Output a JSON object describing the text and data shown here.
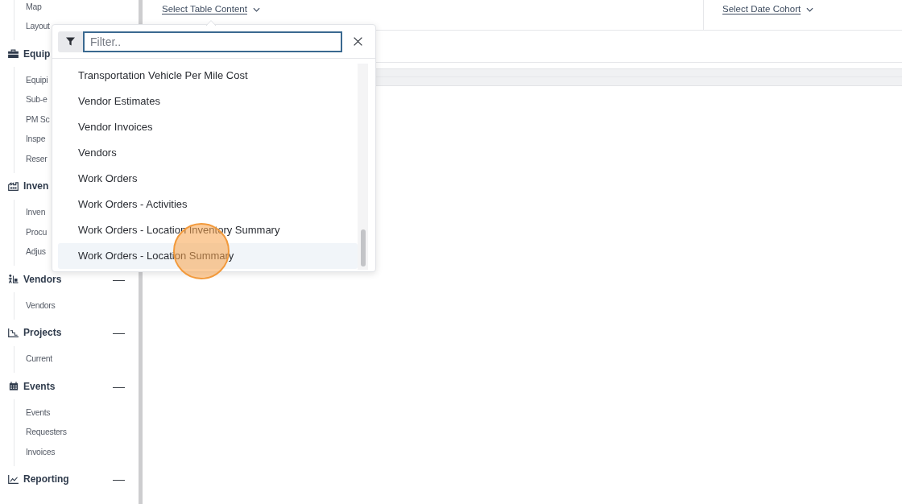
{
  "sidebar": {
    "items": [
      {
        "label": "Map"
      },
      {
        "label": "Layout"
      }
    ],
    "sections": [
      {
        "label": "Equip",
        "items": [
          {
            "label": "Equipi"
          },
          {
            "label": "Sub-e"
          },
          {
            "label": "PM Sc"
          },
          {
            "label": "Inspe"
          },
          {
            "label": "Reser"
          }
        ]
      },
      {
        "label": "Inven",
        "items": [
          {
            "label": "Inven"
          },
          {
            "label": "Procu"
          },
          {
            "label": "Adjus"
          }
        ]
      },
      {
        "label": "Vendors",
        "toggle": "—",
        "items": [
          {
            "label": "Vendors"
          }
        ]
      },
      {
        "label": "Projects",
        "toggle": "—",
        "items": [
          {
            "label": "Current"
          }
        ]
      },
      {
        "label": "Events",
        "toggle": "—",
        "items": [
          {
            "label": "Events"
          },
          {
            "label": "Requesters"
          },
          {
            "label": "Invoices"
          }
        ]
      },
      {
        "label": "Reporting",
        "toggle": "—"
      }
    ]
  },
  "toolbar": {
    "table_content": {
      "label": "Select Table Content"
    },
    "date_cohort": {
      "label": "Select Date Cohort"
    }
  },
  "dropdown": {
    "filter": {
      "placeholder": "Filter.."
    },
    "options": [
      {
        "label": "Transportation Vehicle Per Mile Cost",
        "highlighted": false
      },
      {
        "label": "Vendor Estimates",
        "highlighted": false
      },
      {
        "label": "Vendor Invoices",
        "highlighted": false
      },
      {
        "label": "Vendors",
        "highlighted": false
      },
      {
        "label": "Work Orders",
        "highlighted": false
      },
      {
        "label": "Work Orders - Activities",
        "highlighted": false
      },
      {
        "label": "Work Orders - Location Inventory Summary",
        "highlighted": false
      },
      {
        "label": "Work Orders - Location Summary",
        "highlighted": true
      }
    ]
  }
}
